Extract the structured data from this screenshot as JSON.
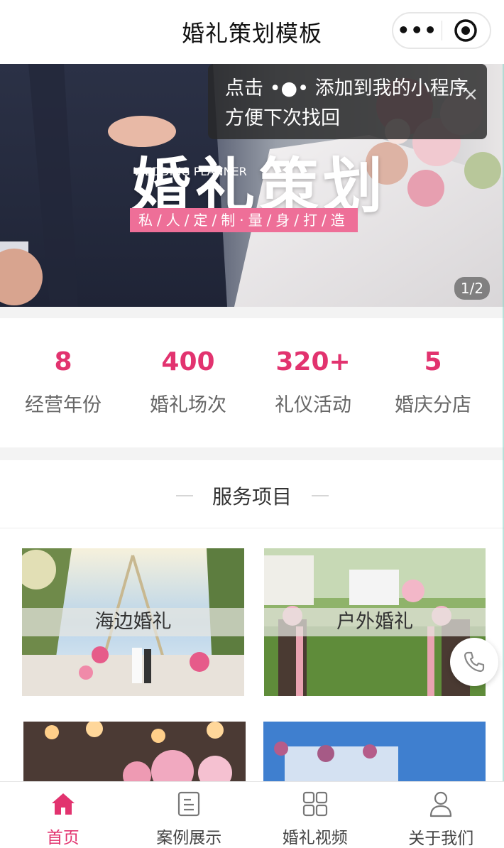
{
  "header": {
    "title": "婚礼策划模板",
    "more_label": "•••"
  },
  "tip": {
    "text_line1": "点击 •●• 添加到我的小程序",
    "text_line2": "方便下次找回",
    "close_label": "×"
  },
  "banner": {
    "title": "婚礼策划",
    "subtitle_en": "WEDDING PLANNER",
    "tagline": "私/人/定/制·量/身/打/造",
    "page_indicator": "1/2",
    "current_slide": 1,
    "total_slides": 2
  },
  "stats": [
    {
      "number": "8",
      "label": "经营年份"
    },
    {
      "number": "400",
      "label": "婚礼场次"
    },
    {
      "number": "320+",
      "label": "礼仪活动"
    },
    {
      "number": "5",
      "label": "婚庆分店"
    }
  ],
  "services": {
    "heading": "服务项目",
    "items": [
      {
        "label": "海边婚礼"
      },
      {
        "label": "户外婚礼"
      },
      {
        "label": ""
      },
      {
        "label": ""
      }
    ]
  },
  "tabbar": {
    "items": [
      {
        "label": "首页",
        "icon": "home-icon",
        "active": true
      },
      {
        "label": "案例展示",
        "icon": "document-icon",
        "active": false
      },
      {
        "label": "婚礼视频",
        "icon": "grid-icon",
        "active": false
      },
      {
        "label": "关于我们",
        "icon": "user-icon",
        "active": false
      }
    ]
  },
  "colors": {
    "accent": "#e2336f",
    "tag_pink": "#ee6f98",
    "tip_bg": "#282828"
  },
  "floating": {
    "icon": "phone-icon"
  }
}
